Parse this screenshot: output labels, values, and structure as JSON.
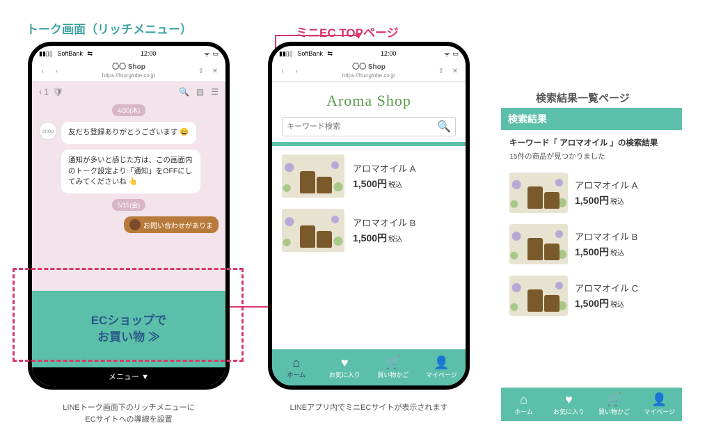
{
  "colors": {
    "accent": "#5cbfa9",
    "highlight": "#d9386a",
    "brand_green": "#5a9a4a"
  },
  "headings": {
    "talk": "トーク画面（リッチメニュー）",
    "ectop": "ミニEC TOPページ",
    "search": "検索結果一覧ページ"
  },
  "statusbar": {
    "carrier": "SoftBank",
    "time": "12:00"
  },
  "urlbar": {
    "shop": "〇〇 Shop",
    "url": "https://fourglobe.co.jp"
  },
  "talk": {
    "back": "‹ 1",
    "date1": "4/30(木)",
    "msg1": "友だち登録ありがとうございます",
    "msg2": "通知が多いと感じた方は、この画面内のトーク設定より「通知」をOFFにしてみてくださいね",
    "date2": "5/15(金)",
    "msg3": "お問い合わせがありま",
    "richmenu_l1": "ECショップで",
    "richmenu_l2": "お買い物 ≫",
    "menubar": "メニュー ▼"
  },
  "caption1_l1": "LINEトーク画面下のリッチメニューに",
  "caption1_l2": "ECサイトへの導線を設置",
  "caption2": "LINEアプリ内でミニECサイトが表示されます",
  "ec": {
    "logo": "Aroma Shop",
    "search_placeholder": "キーワード検索",
    "products": [
      {
        "name": "アロマオイル A",
        "price": "1,500円",
        "tax": "税込"
      },
      {
        "name": "アロマオイル B",
        "price": "1,500円",
        "tax": "税込"
      }
    ],
    "tabs": [
      {
        "icon": "home",
        "label": "ホーム"
      },
      {
        "icon": "heart",
        "label": "お気に入り"
      },
      {
        "icon": "cart",
        "label": "買い物かご"
      },
      {
        "icon": "user",
        "label": "マイページ"
      }
    ]
  },
  "results": {
    "header": "検索結果",
    "keyword_line": "キーワード「 アロマオイル 」の検索結果",
    "count_line": "15件の商品が見つかりました",
    "products": [
      {
        "name": "アロマオイル A",
        "price": "1,500円",
        "tax": "税込"
      },
      {
        "name": "アロマオイル B",
        "price": "1,500円",
        "tax": "税込"
      },
      {
        "name": "アロマオイル C",
        "price": "1,500円",
        "tax": "税込"
      }
    ],
    "tabs": [
      {
        "icon": "home",
        "label": "ホーム"
      },
      {
        "icon": "heart",
        "label": "お気に入り"
      },
      {
        "icon": "cart",
        "label": "買い物かご"
      },
      {
        "icon": "user",
        "label": "マイページ"
      }
    ]
  }
}
